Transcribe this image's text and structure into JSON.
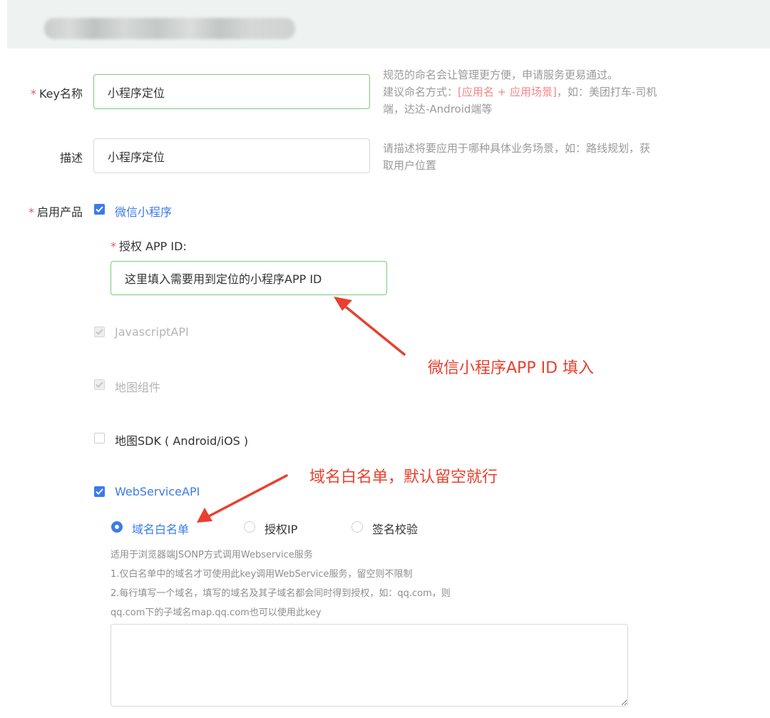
{
  "header": {
    "title_blurred": ""
  },
  "form": {
    "key_name": {
      "label": "Key名称",
      "required_mark": "*",
      "value": "小程序定位",
      "hint_line1": "规范的命名会让管理更方便，申请服务更易通过。",
      "hint_line2_prefix": "建议命名方式：",
      "hint_line2_highlight": "[应用名 + 应用场景]",
      "hint_line2_suffix": "，如：美团打车-司机",
      "hint_line3": "端，达达-Android端等"
    },
    "description": {
      "label": "描述",
      "value": "小程序定位",
      "hint_line1": "请描述将要应用于哪种具体业务场景，如：路线规划，获",
      "hint_line2": "取用户位置"
    },
    "products": {
      "label": "启用产品",
      "required_mark": "*",
      "wechat": {
        "label": "微信小程序",
        "checked": true
      },
      "app_id": {
        "required_mark": "*",
        "label": "授权 APP ID:",
        "value": "这里填入需要用到定位的小程序APP ID"
      },
      "javascript_api": {
        "label": "JavascriptAPI",
        "checked": true,
        "disabled": true
      },
      "map_component": {
        "label": "地图组件",
        "checked": true,
        "disabled": true
      },
      "map_sdk": {
        "label": "地图SDK ( Android/iOS )",
        "checked": false
      },
      "webservice_api": {
        "label": "WebServiceAPI",
        "checked": true
      },
      "auth_modes": [
        {
          "label": "域名白名单",
          "selected": true
        },
        {
          "label": "授权IP",
          "selected": false
        },
        {
          "label": "签名校验",
          "selected": false
        }
      ],
      "whitelist_help": [
        "适用于浏览器端JSONP方式调用Webservice服务",
        "1.仅白名单中的域名才可使用此key调用WebService服务，留空则不限制",
        "2.每行填写一个域名，填写的域名及其子域名都会同时得到授权，如：qq.com，则",
        "qq.com下的子域名map.qq.com也可以使用此key"
      ],
      "whitelist_value": ""
    }
  },
  "annotations": {
    "appid_note": "微信小程序APP ID 填入",
    "whitelist_note": "域名白名单，默认留空就行"
  },
  "colors": {
    "accent": "#3b7bea",
    "annotation": "#e8402e",
    "active_border": "#7dc97a",
    "required": "#f5534b"
  }
}
